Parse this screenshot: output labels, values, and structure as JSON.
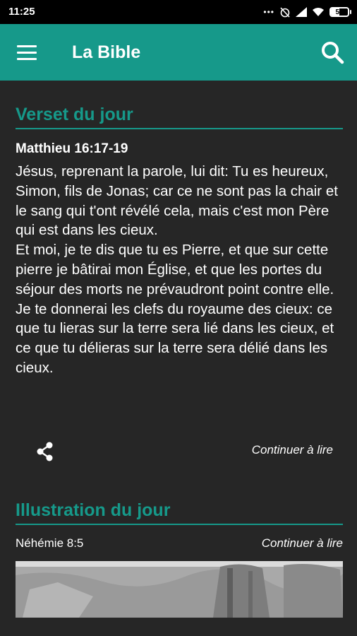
{
  "status": {
    "time": "11:25",
    "battery": "50",
    "battery_level": 0.5
  },
  "app_bar": {
    "title": "La Bible"
  },
  "verse_of_day": {
    "section_title": "Verset du jour",
    "reference": "Matthieu 16:17-19",
    "paragraphs": [
      "Jésus, reprenant la parole, lui dit: Tu es heureux, Simon, fils de Jonas; car ce ne sont pas la chair et le sang qui t'ont révélé cela, mais c'est mon Père qui est dans les cieux.",
      "Et moi, je te dis que tu es Pierre, et que sur cette pierre je bâtirai mon Église, et que les portes du séjour des morts ne prévaudront point contre elle.",
      "Je te donnerai les clefs du royaume des cieux: ce que tu lieras sur la terre sera lié dans les cieux, et ce que tu délieras sur la terre sera délié dans les cieux."
    ],
    "continue_label": "Continuer à lire"
  },
  "illustration_of_day": {
    "section_title": "Illustration du jour",
    "reference": "Néhémie 8:5",
    "continue_label": "Continuer à lire"
  },
  "colors": {
    "accent": "#16998a",
    "background": "#262626",
    "status_bar": "#000000"
  }
}
